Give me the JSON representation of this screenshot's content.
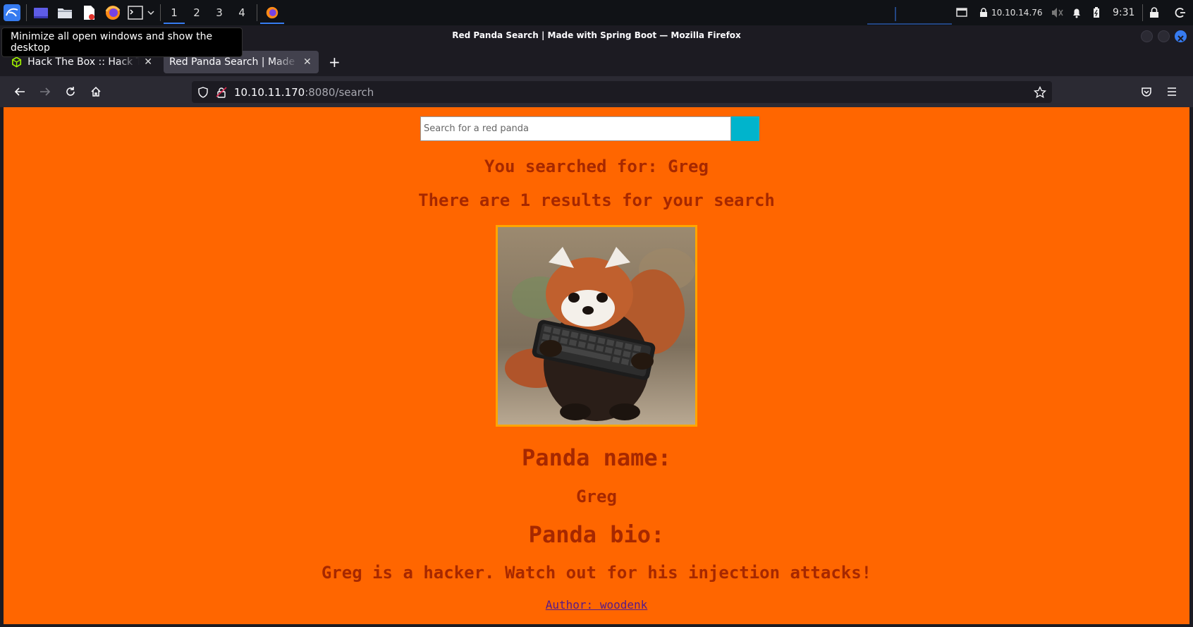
{
  "taskbar": {
    "workspaces": [
      "1",
      "2",
      "3",
      "4"
    ],
    "ip_address": "10.10.14.76",
    "clock": "9:31",
    "tooltip": "Minimize all open windows and show the desktop"
  },
  "window": {
    "title": "Red Panda Search | Made with Spring Boot — Mozilla Firefox"
  },
  "tabs": [
    {
      "label": "Hack The Box :: Hack The Box"
    },
    {
      "label": "Red Panda Search | Made with Spring Boot"
    }
  ],
  "urlbar": {
    "host": "10.10.11.170",
    "rest": ":8080/search"
  },
  "page": {
    "search_placeholder": "Search for a red panda",
    "searched_for": "You searched for: Greg",
    "results_count": "There are 1 results for your search",
    "panda_name_heading": "Panda name:",
    "panda_name": "Greg",
    "panda_bio_heading": "Panda bio:",
    "panda_bio": "Greg is a hacker. Watch out for his injection attacks!",
    "author_link": "Author: woodenk"
  },
  "colors": {
    "page_background": "#ff6600",
    "heading_text": "#a62800",
    "search_button": "#00b4cc",
    "image_border": "#ffa500",
    "link": "#551a8b"
  }
}
